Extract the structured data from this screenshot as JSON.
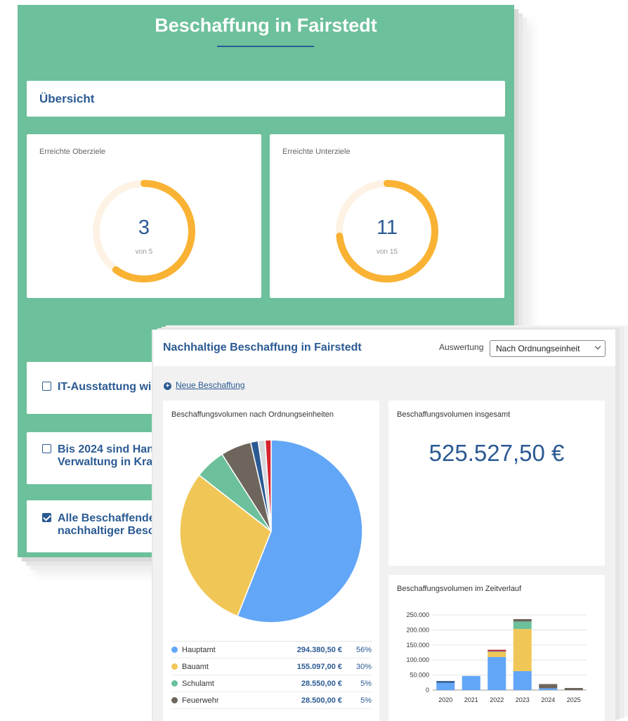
{
  "back": {
    "title": "Beschaffung in Fairstedt",
    "overview_label": "Übersicht",
    "kpis": [
      {
        "label": "Erreichte Oberziele",
        "value": "3",
        "sub": "von 5",
        "progress": 0.6
      },
      {
        "label": "Erreichte Unterziele",
        "value": "11",
        "sub": "von 15",
        "progress": 0.7333
      }
    ],
    "goals": [
      {
        "text_line1": "IT-Ausstattung wir",
        "text_line2": "",
        "checked": false
      },
      {
        "text_line1": "Bis 2024 sind Hand",
        "text_line2": "Verwaltung in Kraf",
        "checked": false
      },
      {
        "text_line1": "Alle Beschaffender",
        "text_line2": "nachhaltiger Besch",
        "checked": true
      }
    ]
  },
  "front": {
    "title": "Nachhaltige Beschaffung in Fairstedt",
    "auswertung_label": "Auswertung",
    "select_value": "Nach Ordnungseinheit",
    "new_link": "Neue Beschaffung",
    "pie_panel_title": "Beschaffungsvolumen nach Ordnungseinheiten",
    "total_panel_title": "Beschaffungsvolumen insgesamt",
    "total_value": "525.527,50 €",
    "bar_panel_title": "Beschaffungsvolumen im Zeitverlauf",
    "legend": [
      {
        "name": "Hauptamt",
        "value": "294.380,50 €",
        "pct": "56%",
        "color": "#62a6f7"
      },
      {
        "name": "Bauamt",
        "value": "155.097,00 €",
        "pct": "30%",
        "color": "#f0c757"
      },
      {
        "name": "Schulamt",
        "value": "28.550,00 €",
        "pct": "5%",
        "color": "#6cc09b"
      },
      {
        "name": "Feuerwehr",
        "value": "28.500,00 €",
        "pct": "5%",
        "color": "#6e655c"
      }
    ]
  },
  "chart_data": [
    {
      "type": "pie",
      "title": "Beschaffungsvolumen nach Ordnungseinheiten",
      "slices": [
        {
          "name": "Hauptamt",
          "value": 294380.5,
          "color": "#62a6f7"
        },
        {
          "name": "Bauamt",
          "value": 155097.0,
          "color": "#f0c757"
        },
        {
          "name": "Schulamt",
          "value": 28550.0,
          "color": "#6cc09b"
        },
        {
          "name": "Feuerwehr",
          "value": 28500.0,
          "color": "#6e655c"
        },
        {
          "name": "",
          "value": 7000,
          "color": "#2b5a93"
        },
        {
          "name": "",
          "value": 6500,
          "color": "#d5d9de"
        },
        {
          "name": "",
          "value": 5500,
          "color": "#d7222f"
        }
      ]
    },
    {
      "type": "bar",
      "stacked": true,
      "title": "Beschaffungsvolumen im Zeitverlauf",
      "categories": [
        "2020",
        "2021",
        "2022",
        "2023",
        "2024",
        "2025"
      ],
      "ylim": [
        0,
        250000
      ],
      "yticks": [
        "0",
        "50.000",
        "100.000",
        "150.000",
        "200.000",
        "250.000"
      ],
      "ytick_values": [
        0,
        50000,
        100000,
        150000,
        200000,
        250000
      ],
      "series": [
        {
          "color": "#62a6f7",
          "values": [
            24000,
            47000,
            110000,
            63000,
            6000,
            0
          ]
        },
        {
          "color": "#f0c757",
          "values": [
            0,
            0,
            18000,
            140000,
            0,
            0
          ]
        },
        {
          "color": "#6cc09b",
          "values": [
            0,
            0,
            0,
            25000,
            0,
            0
          ]
        },
        {
          "color": "#6e655c",
          "values": [
            0,
            0,
            0,
            8000,
            14000,
            7000
          ]
        },
        {
          "color": "#2b5a93",
          "values": [
            6000,
            0,
            2000,
            0,
            0,
            0
          ]
        },
        {
          "color": "#d7222f",
          "values": [
            0,
            0,
            4000,
            0,
            0,
            0
          ]
        }
      ]
    }
  ]
}
